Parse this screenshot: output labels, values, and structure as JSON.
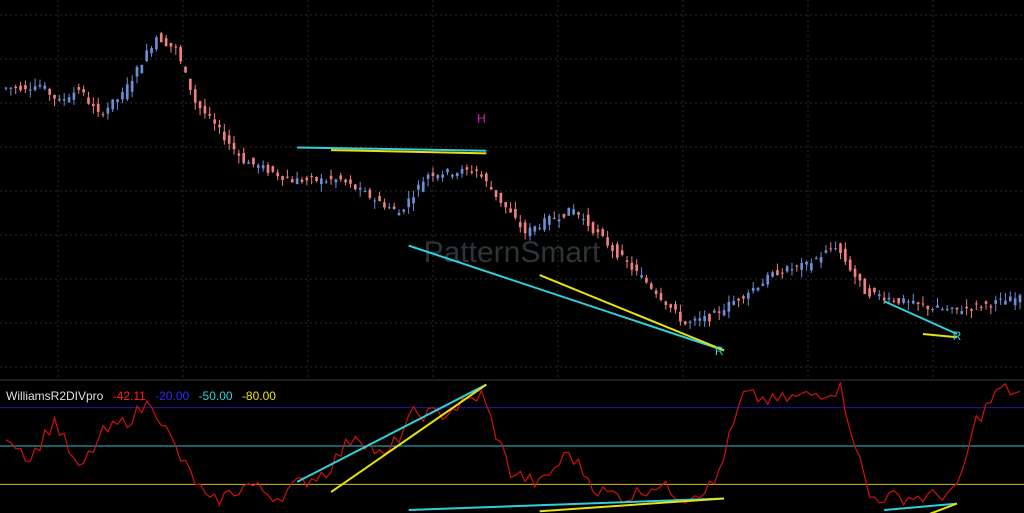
{
  "watermark": "PatternSmart",
  "colors": {
    "background": "#000000",
    "grid": "#2a2a2a",
    "bull_candle": "#6b8fd6",
    "bear_candle": "#f08080",
    "wr_line": "#d01010",
    "cyan": "#30d0d8",
    "yellow": "#e8e010",
    "level_minus20": "#1a1aa8",
    "level_minus50": "#30c0c8",
    "level_minus80": "#c8c010",
    "head_marker": "#e020c0",
    "right_marker": "#30d0d8"
  },
  "markers": [
    {
      "text": "H",
      "bar": 98,
      "price": 132.8,
      "color_key": "head_marker"
    },
    {
      "text": "R",
      "bar": 147,
      "price": 97.3,
      "color_key": "right_marker"
    },
    {
      "text": "R",
      "bar": 196,
      "price": 99.6,
      "color_key": "right_marker"
    }
  ],
  "indicator": {
    "name": "WilliamsR2DIVpro",
    "value": "-42.11",
    "level1": "-20.00",
    "level2": "-50.00",
    "level3": "-80.00"
  },
  "chart_data": {
    "type": "candlestick",
    "bars": 210,
    "price_scale": {
      "min": 95,
      "max": 150
    },
    "price_key_points": [
      [
        0,
        138
      ],
      [
        8,
        138.5
      ],
      [
        12,
        136
      ],
      [
        16,
        138
      ],
      [
        20,
        134
      ],
      [
        25,
        137
      ],
      [
        32,
        146
      ],
      [
        36,
        144
      ],
      [
        40,
        136
      ],
      [
        50,
        127
      ],
      [
        60,
        124
      ],
      [
        70,
        124
      ],
      [
        82,
        119
      ],
      [
        88,
        125
      ],
      [
        98,
        125.5
      ],
      [
        108,
        116
      ],
      [
        113,
        118
      ],
      [
        118,
        119.5
      ],
      [
        128,
        112
      ],
      [
        135,
        107
      ],
      [
        141,
        102
      ],
      [
        146,
        103
      ],
      [
        150,
        105
      ],
      [
        160,
        110
      ],
      [
        166,
        111
      ],
      [
        172,
        114
      ],
      [
        178,
        107
      ],
      [
        188,
        105
      ],
      [
        196,
        104
      ],
      [
        210,
        106
      ]
    ],
    "wr_scale": {
      "min": -100,
      "max": 0
    },
    "wr_levels": [
      -20,
      -50,
      -80
    ],
    "wr_key_points": [
      [
        0,
        -40
      ],
      [
        5,
        -60
      ],
      [
        10,
        -30
      ],
      [
        15,
        -70
      ],
      [
        20,
        -40
      ],
      [
        25,
        -30
      ],
      [
        30,
        -15
      ],
      [
        36,
        -60
      ],
      [
        42,
        -95
      ],
      [
        50,
        -80
      ],
      [
        56,
        -90
      ],
      [
        60,
        -80
      ],
      [
        66,
        -70
      ],
      [
        72,
        -40
      ],
      [
        78,
        -60
      ],
      [
        84,
        -25
      ],
      [
        90,
        -25
      ],
      [
        98,
        -10
      ],
      [
        104,
        -70
      ],
      [
        110,
        -80
      ],
      [
        116,
        -55
      ],
      [
        122,
        -85
      ],
      [
        128,
        -90
      ],
      [
        134,
        -80
      ],
      [
        140,
        -90
      ],
      [
        146,
        -80
      ],
      [
        152,
        -10
      ],
      [
        158,
        -15
      ],
      [
        166,
        -10
      ],
      [
        172,
        -5
      ],
      [
        178,
        -90
      ],
      [
        184,
        -90
      ],
      [
        190,
        -90
      ],
      [
        196,
        -85
      ],
      [
        200,
        -30
      ],
      [
        205,
        -5
      ],
      [
        210,
        -10
      ]
    ],
    "divergences": [
      {
        "pane": "price",
        "color_key": "cyan",
        "from": [
          60,
          129
        ],
        "to": [
          99,
          128.5
        ]
      },
      {
        "pane": "price",
        "color_key": "yellow",
        "from": [
          67,
          128.6
        ],
        "to": [
          99,
          128.1
        ]
      },
      {
        "pane": "price",
        "color_key": "cyan",
        "from": [
          83,
          114
        ],
        "to": [
          148,
          98
        ]
      },
      {
        "pane": "price",
        "color_key": "yellow",
        "from": [
          110,
          109.5
        ],
        "to": [
          148,
          98
        ]
      },
      {
        "pane": "price",
        "color_key": "cyan",
        "from": [
          181,
          105.5
        ],
        "to": [
          196,
          100.5
        ]
      },
      {
        "pane": "price",
        "color_key": "yellow",
        "from": [
          189,
          100.5
        ],
        "to": [
          196,
          100
        ]
      },
      {
        "pane": "wr",
        "color_key": "cyan",
        "from": [
          60,
          -78
        ],
        "to": [
          99,
          -2
        ]
      },
      {
        "pane": "wr",
        "color_key": "yellow",
        "from": [
          67,
          -86
        ],
        "to": [
          99,
          -2
        ]
      },
      {
        "pane": "wr",
        "color_key": "cyan",
        "from": [
          83,
          -100
        ],
        "to": [
          148,
          -91
        ]
      },
      {
        "pane": "wr",
        "color_key": "yellow",
        "from": [
          110,
          -101
        ],
        "to": [
          148,
          -91
        ]
      },
      {
        "pane": "wr",
        "color_key": "cyan",
        "from": [
          181,
          -100
        ],
        "to": [
          196,
          -95
        ]
      },
      {
        "pane": "wr",
        "color_key": "yellow",
        "from": [
          189,
          -105
        ],
        "to": [
          196,
          -95
        ]
      }
    ]
  }
}
